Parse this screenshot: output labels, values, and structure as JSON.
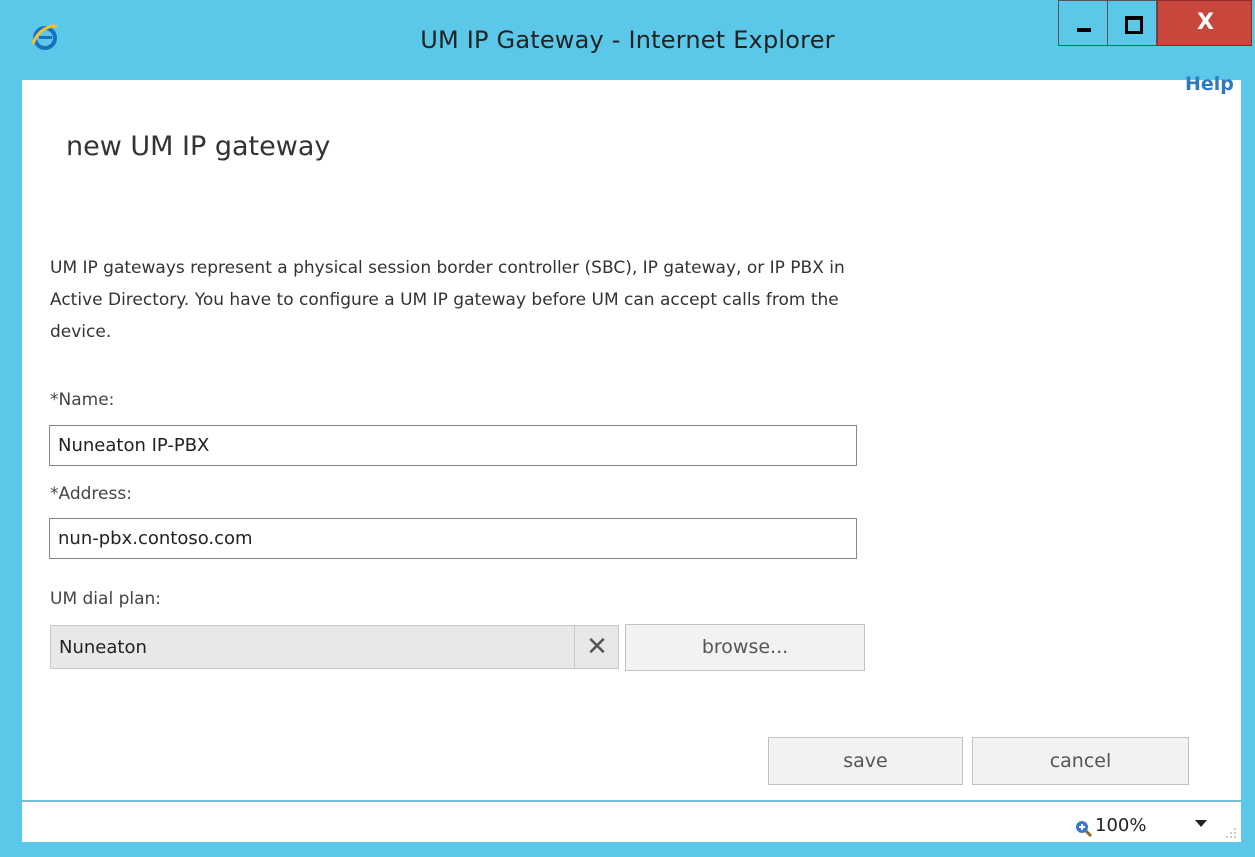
{
  "window": {
    "title": "UM IP Gateway - Internet Explorer",
    "close_glyph": "X",
    "colors": {
      "titlebar": "#5bc8ea",
      "close": "#c8473c",
      "link": "#2b7bc3"
    }
  },
  "header": {
    "help_label": "Help",
    "page_title": "new UM IP gateway"
  },
  "form": {
    "description": "UM IP gateways represent a physical session border controller (SBC), IP gateway, or IP PBX in Active Directory. You have to configure a UM IP gateway before UM can accept calls from the device.",
    "name_label": "*Name:",
    "name_value": "Nuneaton IP-PBX",
    "address_label": "*Address:",
    "address_value": "nun-pbx.contoso.com",
    "dial_plan_label": "UM dial plan:",
    "dial_plan_value": "Nuneaton",
    "clear_glyph": "✕",
    "browse_label": "browse..."
  },
  "actions": {
    "save_label": "save",
    "cancel_label": "cancel"
  },
  "statusbar": {
    "zoom_level": "100%"
  }
}
